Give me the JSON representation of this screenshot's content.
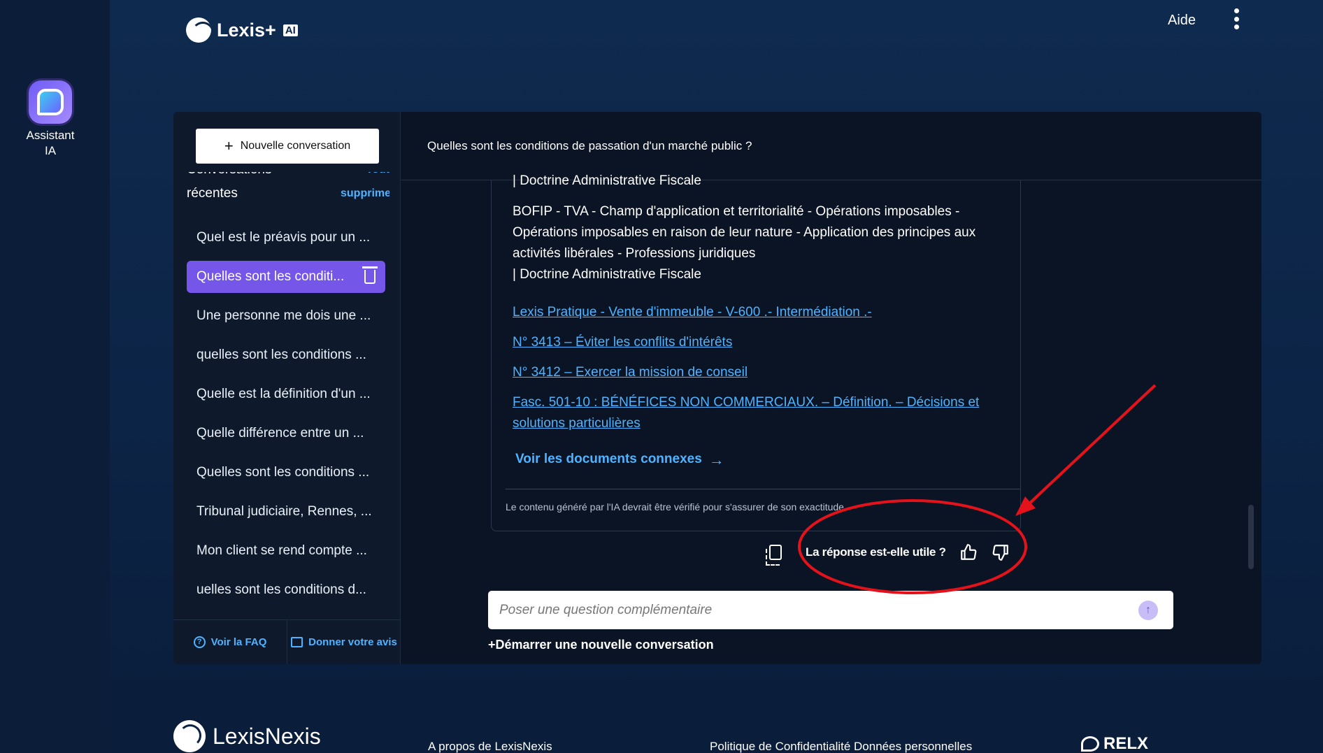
{
  "app": {
    "logo_text": "Lexis+",
    "logo_badge": "AI"
  },
  "rail": {
    "label_line1": "Assistant",
    "label_line2": "IA"
  },
  "header": {
    "help": "Aide"
  },
  "sidebar": {
    "new_conversation": "Nouvelle conversation",
    "recent_title": "Conversations récentes",
    "delete_all": "Tout supprimer",
    "conversations": [
      "Quel est le préavis pour un ...",
      "Quelles sont les conditi...",
      "Une personne me dois une ...",
      "quelles sont les conditions ...",
      "Quelle est la définition d'un ...",
      "Quelle différence entre un ...",
      "Quelles sont les conditions ...",
      "Tribunal judiciaire, Rennes, ...",
      "Mon client se rend compte ...",
      "uelles sont les conditions d..."
    ],
    "faq": "Voir la FAQ",
    "feedback": "Donner votre avis"
  },
  "question": "Quelles sont les conditions de passation d'un marché public ?",
  "answer": {
    "clipped_line": "| Doctrine Administrative Fiscale",
    "ref_text": "BOFIP - TVA - Champ d'application et territorialité - Opérations imposables - Opérations imposables en raison de leur nature - Application des principes aux activités libérales - Professions juridiques",
    "ref_source": "| Doctrine Administrative Fiscale",
    "links": [
      "Lexis Pratique - Vente d'immeuble - V-600 .- Intermédiation .-",
      "N° 3413 – Éviter les conflits d'intérêts",
      "N° 3412 – Exercer la mission de conseil",
      "Fasc. 501-10 : BÉNÉFICES NON COMMERCIAUX. – Définition. – Décisions et solutions particulières"
    ],
    "related_docs": "Voir les documents connexes",
    "disclaimer": "Le contenu généré par l'IA devrait être vérifié pour s'assurer de son exactitude."
  },
  "feedback_bar": {
    "question": "La réponse est-elle utile ?"
  },
  "composer": {
    "placeholder": "Poser une question complémentaire",
    "start_new": "+Démarrer une nouvelle conversation"
  },
  "footer": {
    "brand": "LexisNexis",
    "about": "A propos de LexisNexis",
    "privacy": "Politique de Confidentialité Données personnelles",
    "relx": "RELX"
  },
  "colors": {
    "accent": "#7457e8",
    "link": "#4fb3ff",
    "annotation": "#e3121b"
  },
  "icons": [
    "assistant-ai-icon",
    "kebab-menu-icon",
    "plus-icon",
    "trash-icon",
    "help-circle-icon",
    "feedback-icon",
    "arrow-right-icon",
    "copy-icon",
    "thumbs-up-icon",
    "thumbs-down-icon",
    "send-arrow-icon"
  ]
}
